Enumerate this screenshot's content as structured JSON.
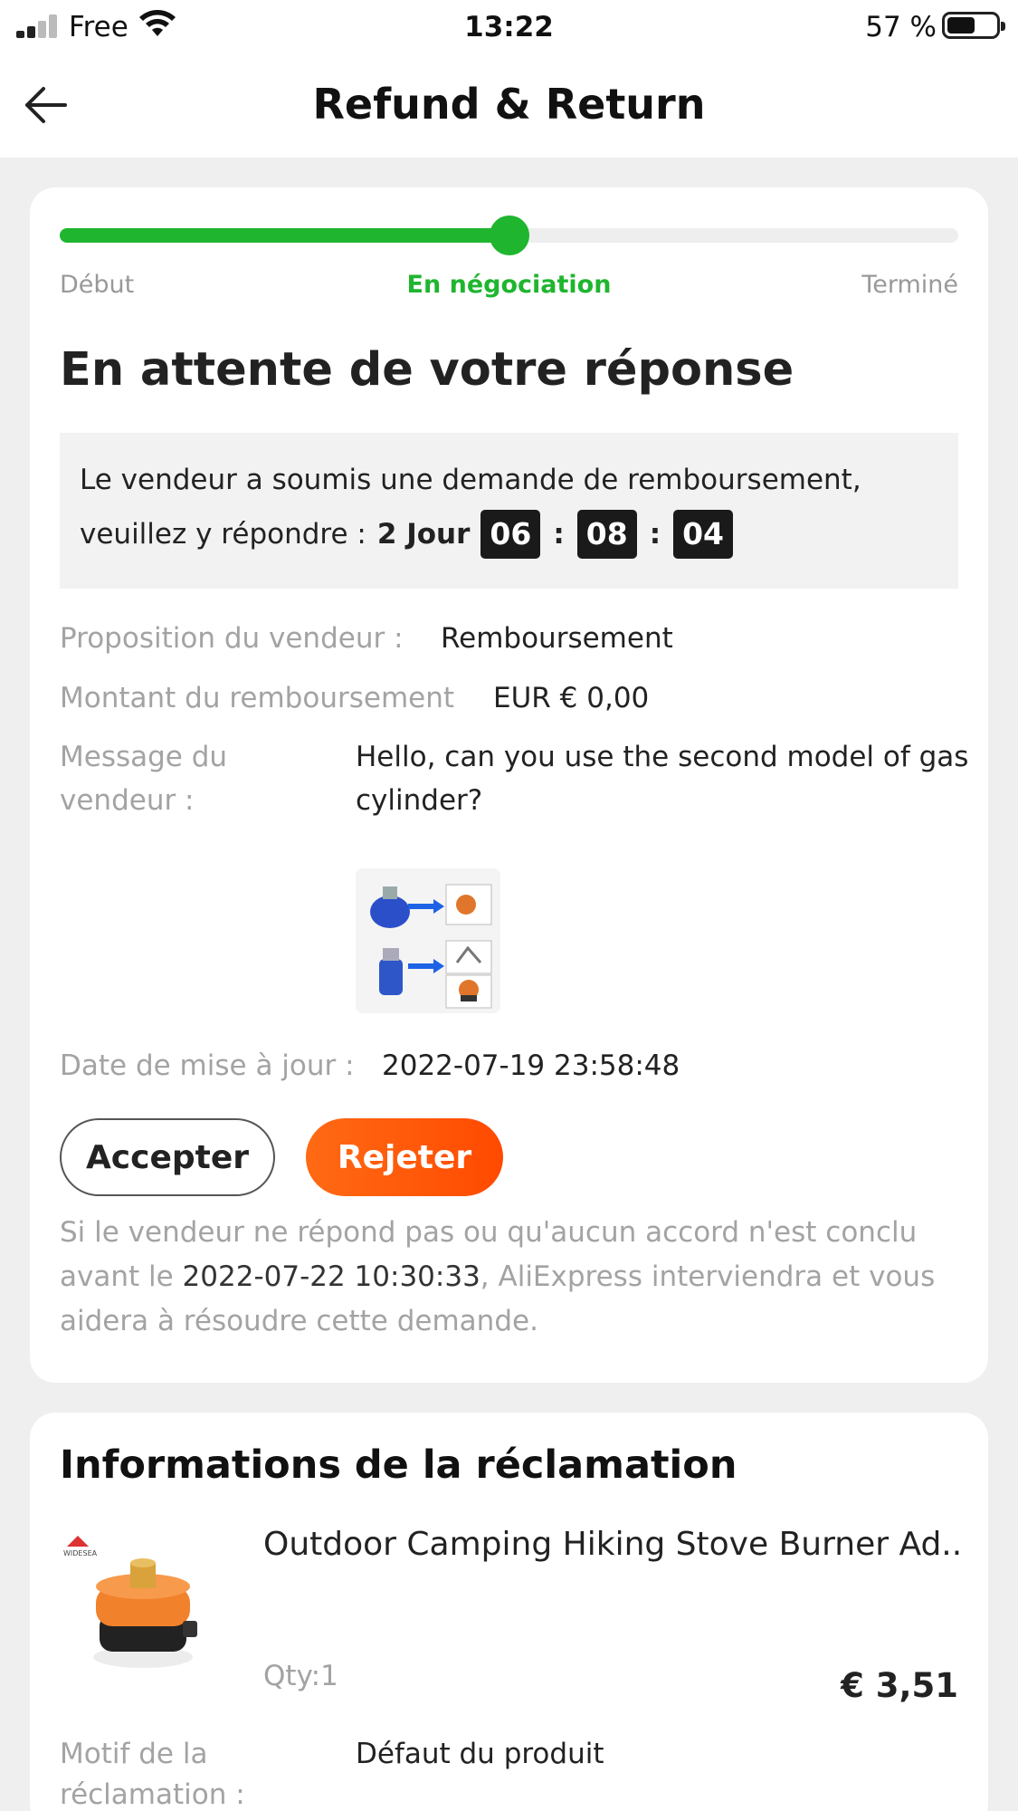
{
  "status_bar": {
    "carrier": "Free",
    "time": "13:22",
    "battery": "57 %"
  },
  "header": {
    "title": "Refund & Return",
    "back_icon": "back-arrow-icon"
  },
  "progress": {
    "steps": [
      "Début",
      "En négociation",
      "Terminé"
    ],
    "current_step": 1,
    "fraction": 0.5,
    "color": "#1fb52f"
  },
  "status": {
    "title": "En attente de votre réponse",
    "notice_line1": "Le vendeur a soumis une demande de remboursement,",
    "notice_line2": "veuillez y répondre :",
    "countdown": {
      "days": "2 Jour",
      "hours": "06",
      "minutes": "08",
      "seconds": "04",
      "separator": ":"
    }
  },
  "details": {
    "proposal_label": "Proposition du vendeur :",
    "proposal_value": "Remboursement",
    "amount_label": "Montant du remboursement",
    "amount_value": "EUR € 0,00",
    "message_label": "Message du vendeur :",
    "message_value": "Hello, can you use the second model of gas cylinder?",
    "updated_label": "Date de mise à jour :",
    "updated_value": "2022-07-19 23:58:48"
  },
  "actions": {
    "accept_label": "Accepter",
    "reject_label": "Rejeter",
    "reject_color": "#ff5a0a"
  },
  "footer_note": {
    "before": "Si le vendeur ne répond pas ou qu'aucun accord n'est conclu avant le ",
    "date": "2022-07-22 10:30:33",
    "after": ", AliExpress interviendra et vous aidera à résoudre cette demande."
  },
  "claim_info": {
    "title": "Informations de la réclamation",
    "item_title": "Outdoor Camping Hiking Stove Burner Ad...",
    "qty": "Qty:1",
    "price": "€ 3,51",
    "brand_logo_text": "WIDESEA",
    "reason_label": "Motif de la réclamation :",
    "reason_value": "Défaut du produit"
  }
}
